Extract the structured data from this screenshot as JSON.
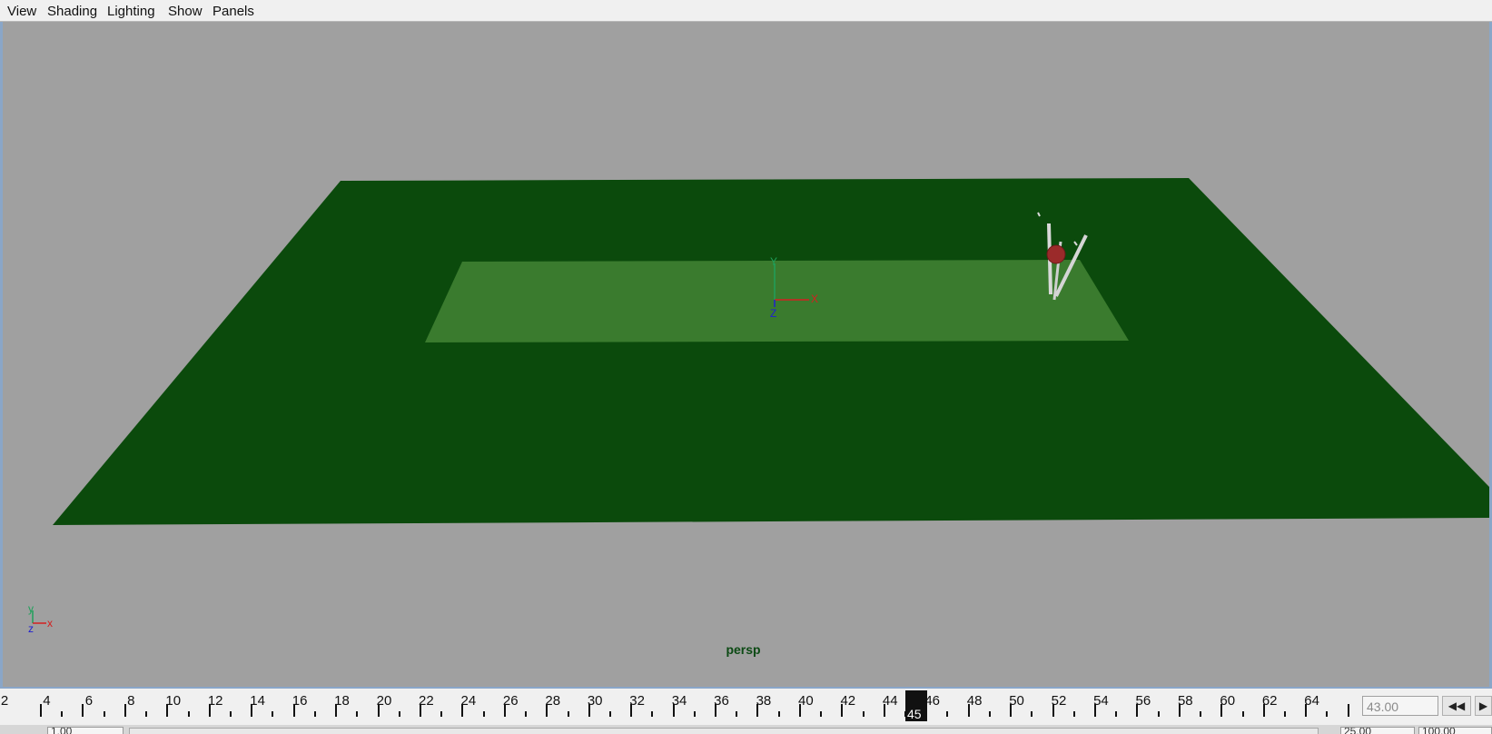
{
  "menu": [
    {
      "id": "view",
      "label": "View"
    },
    {
      "id": "shading",
      "label": "Shading"
    },
    {
      "id": "lighting",
      "label": "Lighting"
    },
    {
      "id": "show",
      "label": "Show"
    },
    {
      "id": "panels",
      "label": "Panels"
    }
  ],
  "viewport": {
    "camera_label": "persp",
    "origin_axes": {
      "x": "X",
      "y": "Y",
      "z": "Z"
    },
    "corner_axes": {
      "x": "x",
      "y": "y",
      "z": "z"
    },
    "colors": {
      "background": "#a0a0a0",
      "ground": "#0b4a0c",
      "pitch": "#3a7b2e",
      "ball": "#9b2a2a",
      "stumps": "#d9d9d9"
    }
  },
  "timeline": {
    "tick_labels": [
      "2",
      "4",
      "6",
      "8",
      "10",
      "12",
      "14",
      "16",
      "18",
      "20",
      "22",
      "24",
      "26",
      "28",
      "30",
      "32",
      "34",
      "36",
      "38",
      "40",
      "42",
      "44",
      "46",
      "48",
      "50",
      "52",
      "54",
      "56",
      "58",
      "60",
      "62",
      "64"
    ],
    "current_frame": "45",
    "current_time": "43.00"
  },
  "playback": {
    "step_back_label": "◀◀",
    "next_label": "▶"
  },
  "range": {
    "start": "1.00",
    "end": "25.00",
    "total": "100.00"
  }
}
